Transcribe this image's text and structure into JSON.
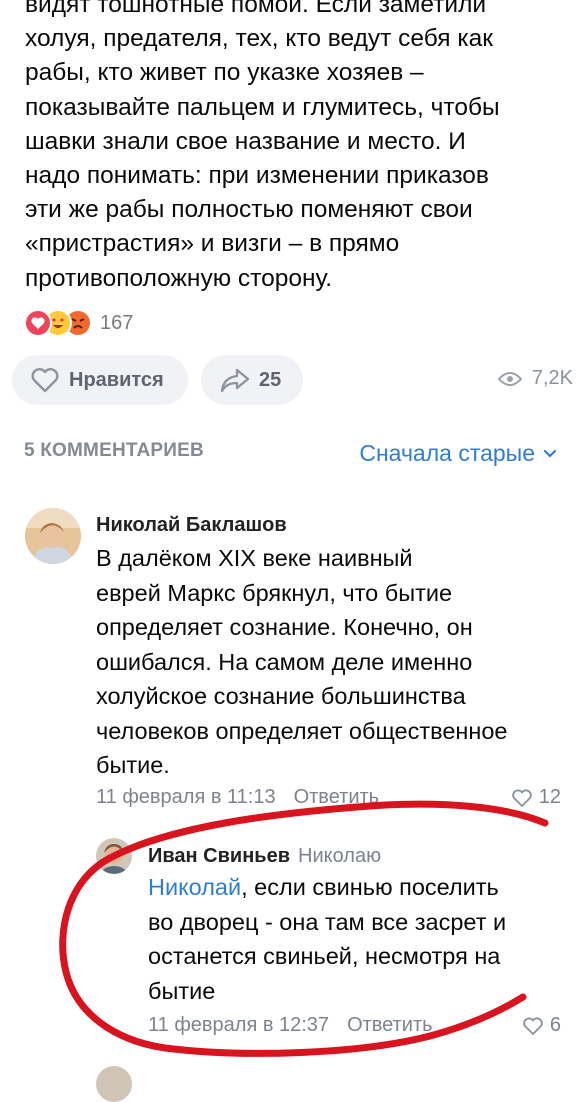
{
  "post": {
    "lines": [
      "видят тошнотные помои. Если заметили",
      "холуя, предателя, тех, кто ведут себя как",
      "рабы, кто живет по указке хозяев –",
      "показывайте пальцем и глумитесь, чтобы",
      "шавки знали свое название и место. И",
      "надо понимать: при изменении приказов",
      "эти же рабы полностью поменяют свои",
      "«пристрастия» и визги – в прямо",
      "противоположную сторону."
    ],
    "reactions_count": "167",
    "reaction_icons": [
      "heart-reaction-icon",
      "love-eyes-reaction-icon",
      "angry-reaction-icon"
    ]
  },
  "actions": {
    "like_label": "Нравится",
    "share_count": "25",
    "views": "7,2K"
  },
  "comments_section": {
    "header": "5 КОММЕНТАРИЕВ",
    "sort_label": "Сначала старые"
  },
  "comments": [
    {
      "author": "Николай Баклашов",
      "lines": [
        "В далёком XIX веке наивный",
        "еврей Маркс брякнул, что бытие",
        "определяет сознание. Конечно, он",
        "ошибался. На самом деле именно",
        "холуйское сознание большинства",
        "человеков определяет общественное",
        "бытие."
      ],
      "time": "11 февраля в 11:13",
      "reply_label": "Ответить",
      "likes": "12"
    },
    {
      "author": "Иван Свиньев",
      "reply_to": "Николаю",
      "mention": "Николай",
      "first_line_rest": ", если свинью поселить",
      "lines": [
        "во дворец - она там все засрет и",
        "останется свиньей, несмотря на",
        "бытие"
      ],
      "time": "11 февраля в 12:37",
      "reply_label": "Ответить",
      "likes": "6"
    }
  ],
  "colors": {
    "accent": "#2f7dd3",
    "secondary_text": "#7d838c",
    "pill_bg": "#f0f2f5",
    "annotation": "#d8141e"
  }
}
